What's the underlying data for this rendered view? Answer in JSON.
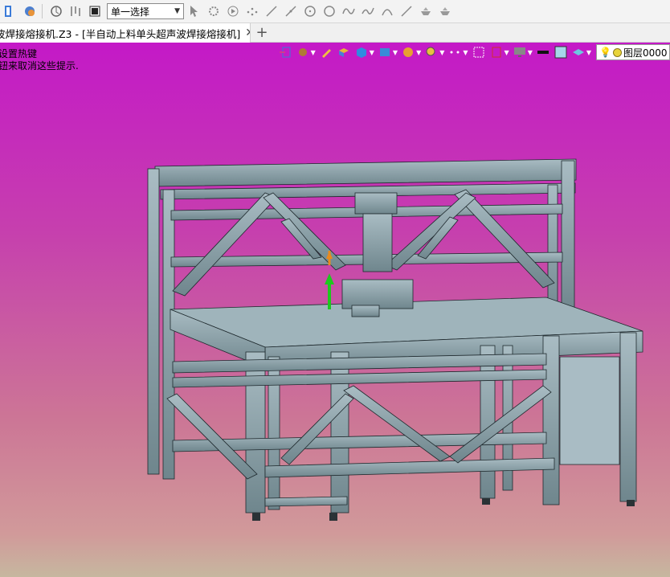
{
  "toolbar": {
    "select_mode": "单一选择",
    "icons": [
      "zw3d-icon",
      "revolve-icon",
      "pick-icon",
      "stop-icon",
      "cursor-icon",
      "gear-filter-icon",
      "play-icon",
      "points-icon",
      "line-icon",
      "line2-icon",
      "circle-icon",
      "circle2-icon",
      "wave-icon",
      "wave2-icon",
      "arc-icon",
      "line3-icon",
      "bowl-icon",
      "bowl2-icon"
    ]
  },
  "tab": {
    "title": "波焊接熔接机.Z3 - [半自动上料单头超声波焊接熔接机]",
    "close": "✕",
    "add": "+"
  },
  "viewport": {
    "hint_line1": "设置热键",
    "hint_line2": "钮来取消这些提示.",
    "layer_label": "图层0000",
    "bg_top": "#c419c7",
    "bg_bottom": "#c6b79f"
  }
}
